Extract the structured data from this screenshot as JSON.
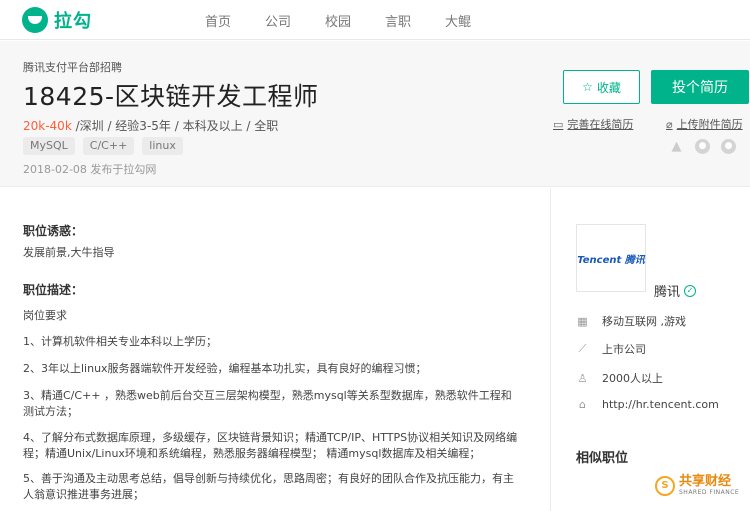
{
  "nav": {
    "logo": "拉勾",
    "items": [
      "首页",
      "公司",
      "校园",
      "言职",
      "大鲲"
    ]
  },
  "job": {
    "company_line": "腾讯支付平台部招聘",
    "title": "18425-区块链开发工程师",
    "salary": "20k-40k",
    "meta": " /深圳 / 经验3-5年 / 本科及以上 / 全职",
    "tags": [
      "MySQL",
      "C/C++",
      "linux"
    ],
    "publish": "2018-02-08  发布于拉勾网",
    "collect_label": "收藏",
    "apply_label": "投个简历",
    "online_resume": "完善在线简历",
    "attach_resume": "上传附件简历"
  },
  "detail": {
    "temptation_title": "职位诱惑：",
    "temptation": "发展前景,大牛指导",
    "desc_title": "职位描述：",
    "requirement_head": "岗位要求",
    "items": [
      "1、计算机软件相关专业本科以上学历；",
      "2、3年以上linux服务器端软件开发经验，编程基本功扎实，具有良好的编程习惯；",
      "3、精通C/C++ ，熟悉web前后台交互三层架构模型，熟悉mysql等关系型数据库，熟悉软件工程和测试方法；",
      "4、了解分布式数据库原理，多级缓存，区块链背景知识；精通TCP/IP、HTTPS协议相关知识及网络编程；精通Unix/Linux环境和系统编程，熟悉服务器编程模型；  精通mysql数据库及相关编程；",
      "5、善于沟通及主动思考总结，倡导创新与持续优化，思路周密；有良好的团队合作及抗压能力，有主人翁意识推进事务进展；"
    ]
  },
  "company": {
    "logo_text": "Tencent 腾讯",
    "name": "腾讯",
    "field": "移动互联网 ,游戏",
    "stage": "上市公司",
    "size": "2000人以上",
    "site": "http://hr.tencent.com",
    "similar_title": "相似职位"
  },
  "watermark": {
    "cn": "共享财经",
    "en": "SHARED FINANCE"
  }
}
